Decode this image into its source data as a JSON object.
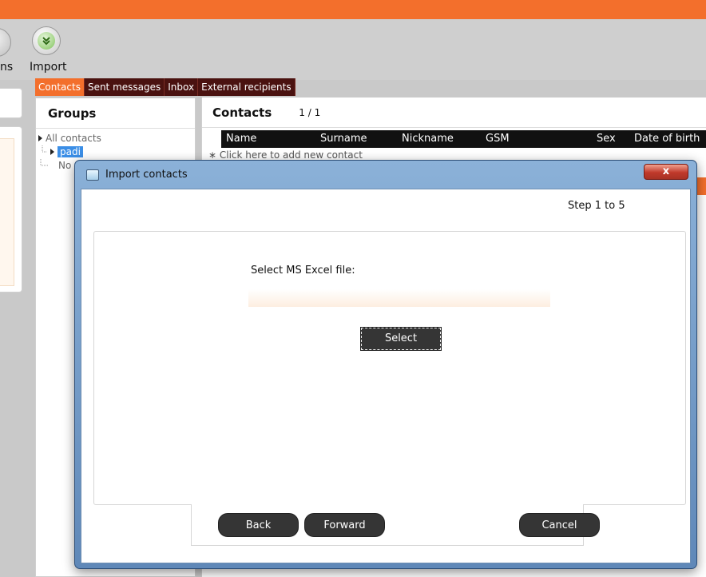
{
  "toolbar": {
    "partial_label": "ns",
    "import_label": "Import",
    "import_icon": "double-chevron-down-icon"
  },
  "tabs": [
    {
      "label": "Contacts",
      "active": true
    },
    {
      "label": "Sent messages",
      "active": false
    },
    {
      "label": "Inbox",
      "active": false
    },
    {
      "label": "External recipients",
      "active": false
    }
  ],
  "groups": {
    "title": "Groups",
    "items": [
      {
        "label": "All contacts"
      },
      {
        "label": "padi",
        "selected": true
      },
      {
        "label": "No"
      }
    ]
  },
  "contacts": {
    "title": "Contacts",
    "page": "1 / 1",
    "columns": [
      "Name",
      "Surname",
      "Nickname",
      "GSM",
      "Sex",
      "Date of birth"
    ],
    "new_row_hint": "Click here to add new contact"
  },
  "dialog": {
    "title": "Import contacts",
    "close_label": "x",
    "step": "Step 1 to 5",
    "file_label": "Select MS Excel file:",
    "file_value": "",
    "select_label": "Select",
    "back_label": "Back",
    "forward_label": "Forward",
    "cancel_label": "Cancel"
  },
  "colors": {
    "accent": "#f36f2c",
    "tab_dark": "#4a1210",
    "selection": "#3b8ee6",
    "button_dark": "#353535"
  }
}
